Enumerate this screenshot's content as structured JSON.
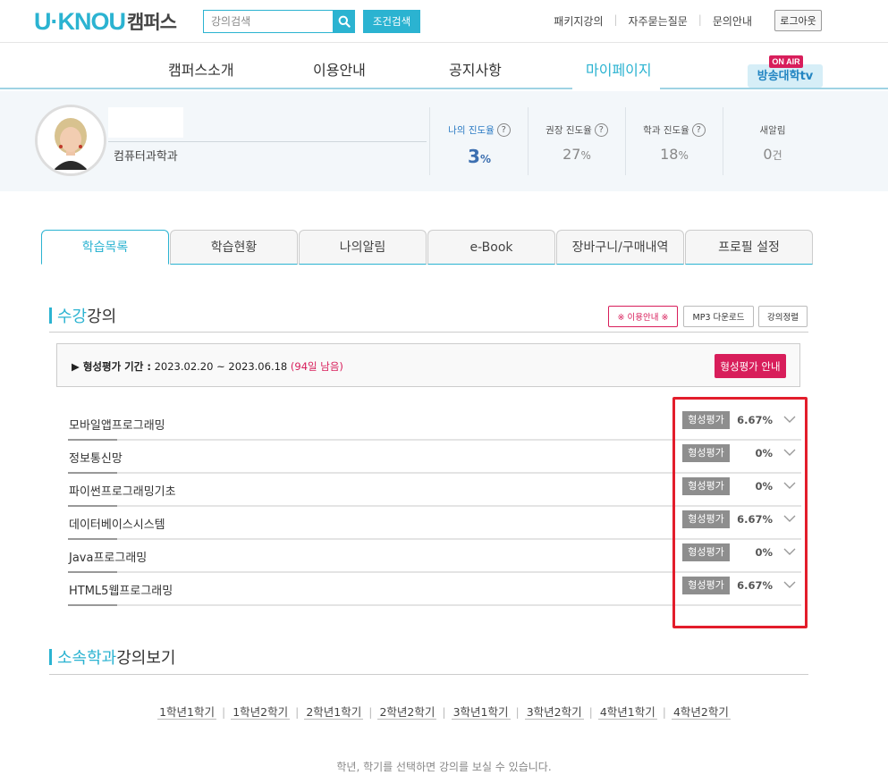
{
  "header": {
    "logo_text": "U·KNOU",
    "logo_suffix": "캠퍼스",
    "search_placeholder": "강의검색",
    "search_button_icon": "search-icon",
    "condition_search_label": "조건검색",
    "links": [
      "패키지강의",
      "자주묻는질문",
      "문의안내"
    ],
    "logout_label": "로그아웃"
  },
  "nav": {
    "items": [
      "캠퍼스소개",
      "이용안내",
      "공지사항",
      "마이페이지"
    ],
    "active": "마이페이지",
    "onair_badge": "ON AIR",
    "onair_label": "방송대학tv"
  },
  "profile": {
    "department": "컴퓨터과학과",
    "stats": [
      {
        "label": "나의 진도율",
        "value": "3",
        "unit": "%",
        "help": true
      },
      {
        "label": "권장 진도율",
        "value": "27",
        "unit": "%",
        "help": true
      },
      {
        "label": "학과 진도율",
        "value": "18",
        "unit": "%",
        "help": true
      },
      {
        "label": "새알림",
        "value": "0",
        "unit": "건",
        "help": false
      }
    ]
  },
  "tabs": [
    "학습목록",
    "학습현황",
    "나의알림",
    "e-Book",
    "장바구니/구매내역",
    "프로필 설정"
  ],
  "active_tab": "학습목록",
  "lectures_section": {
    "title_accent": "수강",
    "title_rest": "강의",
    "buttons": [
      "※ 이용안내 ※",
      "MP3 다운로드",
      "강의정렬"
    ],
    "eval_period_label": "▶ 형성평가 기간 :",
    "eval_period_dates": "2023.02.20 ~ 2023.06.18",
    "eval_period_remaining": "(94일 남음)",
    "eval_guide_button": "형성평가 안내",
    "courses": [
      {
        "title": "모바일앱프로그래밍",
        "tag": "형성평가",
        "progress": "6.67%",
        "progress_value": 6.67
      },
      {
        "title": "정보통신망",
        "tag": "형성평가",
        "progress": "0%",
        "progress_value": 0
      },
      {
        "title": "파이썬프로그래밍기초",
        "tag": "형성평가",
        "progress": "0%",
        "progress_value": 0
      },
      {
        "title": "데이터베이스시스템",
        "tag": "형성평가",
        "progress": "6.67%",
        "progress_value": 6.67
      },
      {
        "title": "Java프로그래밍",
        "tag": "형성평가",
        "progress": "0%",
        "progress_value": 0
      },
      {
        "title": "HTML5웹프로그래밍",
        "tag": "형성평가",
        "progress": "6.67%",
        "progress_value": 6.67
      }
    ]
  },
  "dept_section": {
    "title_accent": "소속학과",
    "title_rest": "강의보기",
    "grades": [
      "1학년1학기",
      "1학년2학기",
      "2학년1학기",
      "2학년2학기",
      "3학년1학기",
      "3학년2학기",
      "4학년1학기",
      "4학년2학기"
    ],
    "hint": "학년, 학기를 선택하면 강의를 보실 수 있습니다."
  },
  "colors": {
    "accent": "#2bb3d1",
    "pink": "#d81e5b",
    "highlight": "#e31d2b"
  }
}
